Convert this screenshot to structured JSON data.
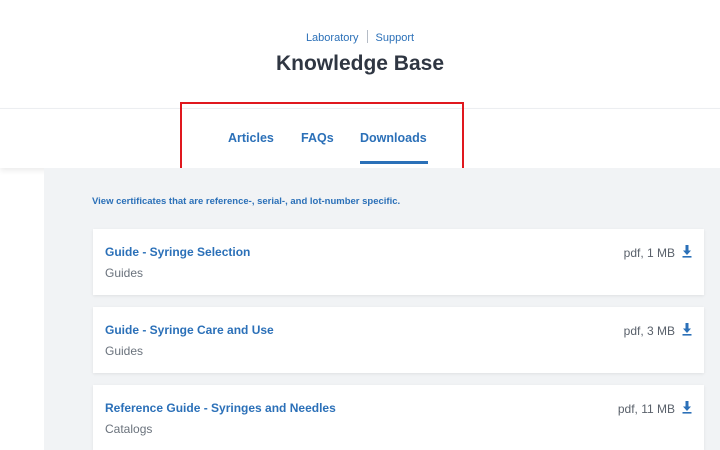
{
  "header": {
    "breadcrumb": [
      "Laboratory",
      "Support"
    ],
    "title": "Knowledge Base"
  },
  "tabs": [
    {
      "label": "Articles",
      "active": false
    },
    {
      "label": "FAQs",
      "active": false
    },
    {
      "label": "Downloads",
      "active": true
    }
  ],
  "intro_text": "View certificates that are reference-, serial-, and lot-number specific.",
  "downloads": [
    {
      "title": "Guide - Syringe Selection",
      "category": "Guides",
      "meta": "pdf, 1 MB"
    },
    {
      "title": "Guide - Syringe Care and Use",
      "category": "Guides",
      "meta": "pdf, 3 MB"
    },
    {
      "title": "Reference Guide - Syringes and Needles",
      "category": "Catalogs",
      "meta": "pdf, 11 MB"
    }
  ],
  "colors": {
    "accent": "#2b70b8",
    "highlight": "#e0181e",
    "background": "#f1f3f5"
  },
  "icons": {
    "download": "download-arrow-icon"
  }
}
